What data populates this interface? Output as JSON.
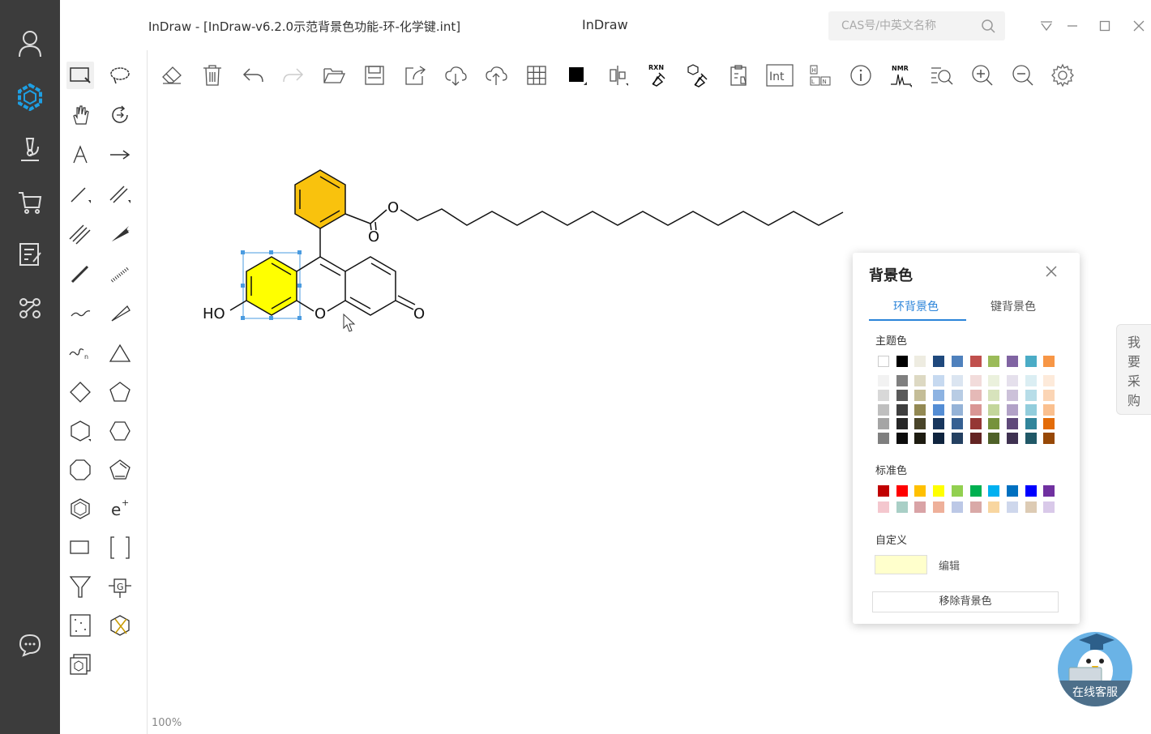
{
  "window": {
    "doc_title": "InDraw - [InDraw-v6.2.0示范背景色功能-环-化学键.int]",
    "app_title": "InDraw",
    "search_placeholder": "CAS号/中英文名称"
  },
  "sidebar": {
    "icons": [
      "user-icon",
      "molecule-logo-icon",
      "microscope-icon",
      "cart-icon",
      "notes-icon",
      "network-icon",
      "chat-icon"
    ]
  },
  "canvas": {
    "zoom_label": "100%",
    "atom_labels": {
      "ho": "HO",
      "ring_o": "O",
      "ketone_o": "O",
      "ester_o_single": "O",
      "ester_o_double": "O"
    },
    "highlight_colors": {
      "phenyl_ring": "#F9C20D",
      "hydroxy_ring": "#FFFF00"
    }
  },
  "color_dialog": {
    "title": "背景色",
    "tabs": {
      "ring": "环背景色",
      "bond": "键背景色"
    },
    "active_tab": "ring",
    "theme_label": "主题色",
    "theme_base": [
      "#FFFFFF",
      "#000000",
      "#EEECE1",
      "#1F497D",
      "#4F81BD",
      "#C0504D",
      "#9BBB59",
      "#8064A2",
      "#4BACC6",
      "#F79646"
    ],
    "theme_shades": [
      [
        "#F2F2F2",
        "#7F7F7F",
        "#DDD9C3",
        "#C6D9F0",
        "#DBE5F1",
        "#F2DCDB",
        "#EBF1DD",
        "#E5E0EC",
        "#DBEEF3",
        "#FDEADA"
      ],
      [
        "#D8D8D8",
        "#595959",
        "#C4BD97",
        "#8DB3E2",
        "#B8CCE4",
        "#E5B9B7",
        "#D7E3BC",
        "#CCC1D9",
        "#B7DDE8",
        "#FBD5B5"
      ],
      [
        "#BFBFBF",
        "#3F3F3F",
        "#938953",
        "#548DD4",
        "#95B3D7",
        "#D99694",
        "#C3D69B",
        "#B2A2C7",
        "#92CDDC",
        "#FAC08F"
      ],
      [
        "#A5A5A5",
        "#262626",
        "#494429",
        "#17365D",
        "#366092",
        "#953734",
        "#76923C",
        "#5F497A",
        "#31859B",
        "#E36C09"
      ],
      [
        "#7F7F7F",
        "#0C0C0C",
        "#1D1B10",
        "#0F243E",
        "#244061",
        "#632423",
        "#4F6128",
        "#3F3151",
        "#205867",
        "#974806"
      ]
    ],
    "standard_label": "标准色",
    "standard_colors": [
      [
        "#C00000",
        "#FF0000",
        "#FFC000",
        "#FFFF00",
        "#92D050",
        "#00B050",
        "#00B0F0",
        "#0070C0",
        "#0000FF",
        "#7030A0"
      ],
      [
        "#F4C7CE",
        "#A9CFC6",
        "#D9A3A6",
        "#EEB09A",
        "#BCC8E6",
        "#D9A9A7",
        "#F8D6A0",
        "#CED7EC",
        "#DDCBB4",
        "#D9C9E9"
      ]
    ],
    "custom_label": "自定义",
    "custom_color": "#FFFFCC",
    "edit_label": "编辑",
    "remove_label": "移除背景色"
  },
  "side_widgets": {
    "purchase_label": [
      "我",
      "要",
      "采",
      "购"
    ],
    "customer_service_label": "在线客服"
  }
}
